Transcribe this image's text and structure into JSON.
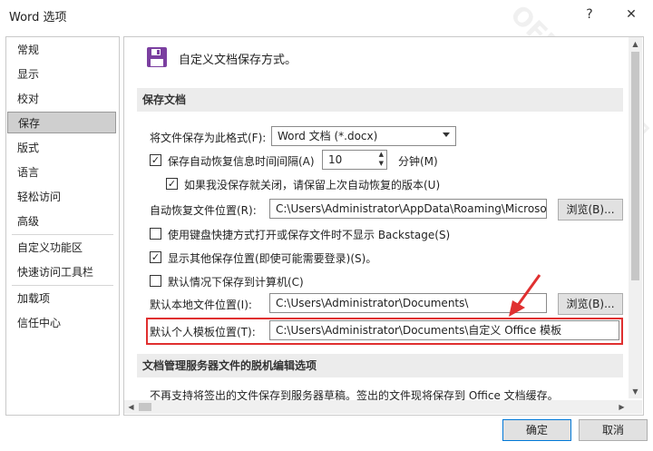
{
  "window": {
    "title": "Word 选项",
    "help_label": "?",
    "close_label": "✕"
  },
  "sidebar": {
    "items": [
      {
        "label": "常规"
      },
      {
        "label": "显示"
      },
      {
        "label": "校对"
      },
      {
        "label": "保存",
        "selected": true
      },
      {
        "label": "版式"
      },
      {
        "label": "语言"
      },
      {
        "label": "轻松访问"
      },
      {
        "label": "高级"
      },
      {
        "label": "自定义功能区"
      },
      {
        "label": "快速访问工具栏"
      },
      {
        "label": "加载项"
      },
      {
        "label": "信任中心"
      }
    ]
  },
  "main": {
    "header_text": "自定义文档保存方式。",
    "sections": {
      "save_docs": "保存文档",
      "offline": "文档管理服务器文件的脱机编辑选项"
    },
    "format": {
      "label": "将文件保存为此格式(F):",
      "value": "Word 文档 (*.docx)"
    },
    "autorecover": {
      "label": "保存自动恢复信息时间间隔(A)",
      "checked": true,
      "minutes": "10",
      "unit": "分钟(M)"
    },
    "keep_last": {
      "label": "如果我没保存就关闭，请保留上次自动恢复的版本(U)",
      "checked": true
    },
    "autorecover_location": {
      "label": "自动恢复文件位置(R):",
      "value": "C:\\Users\\Administrator\\AppData\\Roaming\\Microso",
      "browse": "浏览(B)..."
    },
    "no_backstage": {
      "label": "使用键盘快捷方式打开或保存文件时不显示 Backstage(S)",
      "checked": false
    },
    "show_other": {
      "label": "显示其他保存位置(即使可能需要登录)(S)。",
      "checked": true
    },
    "save_to_computer": {
      "label": "默认情况下保存到计算机(C)",
      "checked": false
    },
    "local_location": {
      "label": "默认本地文件位置(I):",
      "value": "C:\\Users\\Administrator\\Documents\\",
      "browse": "浏览(B)..."
    },
    "template_location": {
      "label": "默认个人模板位置(T):",
      "value": "C:\\Users\\Administrator\\Documents\\自定义 Office 模板"
    },
    "offline_note": "不再支持将签出的文件保存到服务器草稿。签出的文件现将保存到 Office 文档缓存。"
  },
  "footer": {
    "ok_label": "确定",
    "cancel_label": "取消"
  },
  "colors": {
    "selection": "#cfcfcf",
    "highlight_box": "#e03030",
    "arrow": "#e03030",
    "primary_border": "#0078d7",
    "save_icon": "#7b3fa0"
  },
  "icons": [
    "help-icon",
    "close-icon",
    "save-disk-icon",
    "checkmark-icon",
    "dropdown-arrow-icon",
    "spinner-up-icon",
    "spinner-down-icon",
    "scroll-up-icon",
    "scroll-down-icon",
    "scroll-left-icon",
    "scroll-right-icon",
    "red-arrow-icon"
  ]
}
